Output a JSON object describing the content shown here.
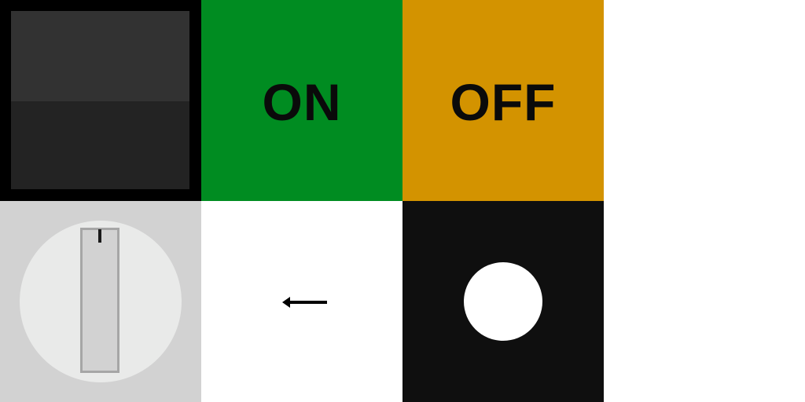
{
  "tiles": {
    "switch": {
      "icon": "rocker-switch-icon",
      "colors": {
        "frame": "#000000",
        "upper": "#323232",
        "lower": "#232323"
      }
    },
    "on": {
      "label": "ON",
      "background": "#008c21"
    },
    "off": {
      "label": "OFF",
      "background": "#d39300"
    },
    "knob": {
      "icon": "rotary-knob-icon",
      "colors": {
        "background": "#d2d2d2",
        "dial": "#e9eae9",
        "grip": "#d2d2d2",
        "grip_border": "#a6a6a6",
        "indicator": "#1a1a1a"
      }
    },
    "arrow": {
      "icon": "arrow-left-icon",
      "colors": {
        "background": "#ffffff",
        "stroke": "#000000"
      }
    },
    "dot": {
      "icon": "circle-dot-icon",
      "colors": {
        "background": "#0f0f0f",
        "dot": "#ffffff"
      }
    }
  }
}
